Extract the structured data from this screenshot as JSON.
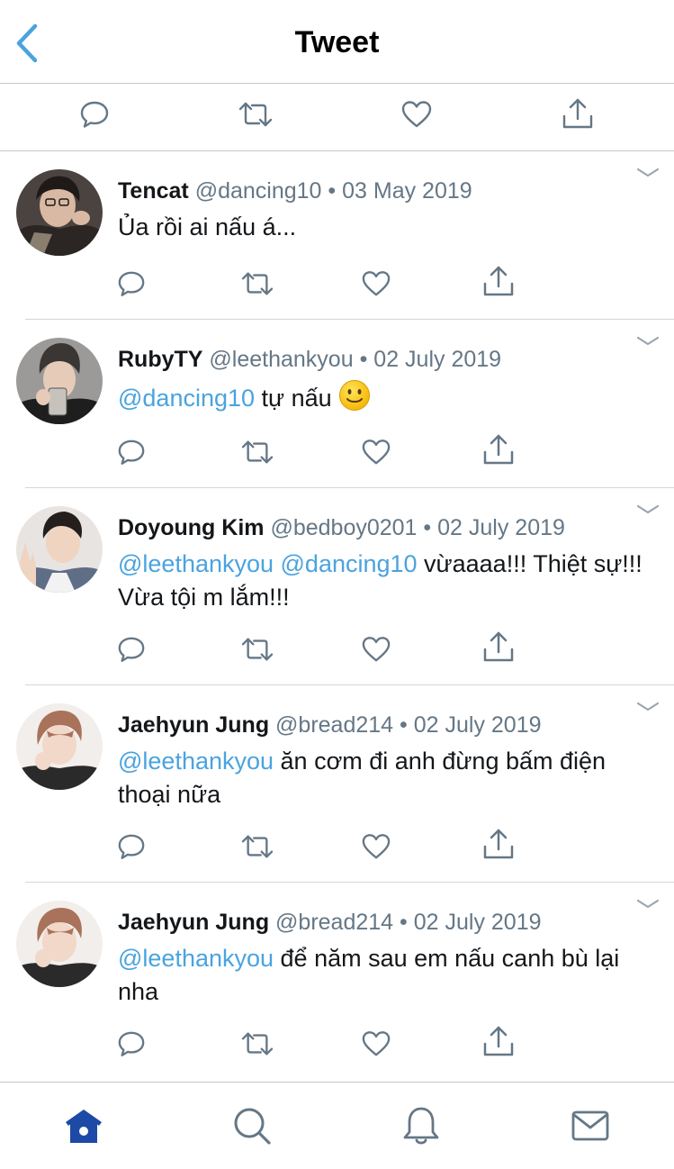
{
  "header": {
    "title": "Tweet",
    "back_icon": "chevron-left-icon",
    "accent_color": "#4aa3df"
  },
  "main_actions": [
    "reply-icon",
    "retweet-icon",
    "like-icon",
    "share-icon"
  ],
  "tweets": [
    {
      "name": "Tencat",
      "handle": "@dancing10",
      "separator": "•",
      "date": "03 May 2019",
      "mentions": "",
      "text": "Ủa rồi ai nấu á...",
      "emoji": ""
    },
    {
      "name": "RubyTY",
      "handle": "@leethankyou",
      "separator": "•",
      "date": "02 July 2019",
      "mentions": "@dancing10",
      "text": " tự nấu ",
      "emoji": "slightly-smiling-face"
    },
    {
      "name": "Doyoung Kim",
      "handle": "@bedboy0201",
      "separator": "•",
      "date": "02 July 2019",
      "mentions": "@leethankyou @dancing10",
      "text": " vừaaaa!!! Thiệt sự!!! Vừa tội m lắm!!!",
      "emoji": ""
    },
    {
      "name": "Jaehyun Jung",
      "handle": "@bread214",
      "separator": "•",
      "date": "02 July 2019",
      "mentions": "@leethankyou",
      "text": " ăn cơm đi anh đừng bấm điện thoại nữa",
      "emoji": ""
    },
    {
      "name": "Jaehyun Jung",
      "handle": "@bread214",
      "separator": "•",
      "date": "02 July 2019",
      "mentions": "@leethankyou",
      "text": " để năm sau em nấu canh bù lại nha",
      "emoji": ""
    }
  ],
  "tabbar": [
    "home-icon",
    "search-icon",
    "notifications-icon",
    "messages-icon"
  ],
  "colors": {
    "link": "#4aa3df",
    "secondary_text": "#657786",
    "icon": "#657786",
    "home_active": "#1c4aa6"
  }
}
